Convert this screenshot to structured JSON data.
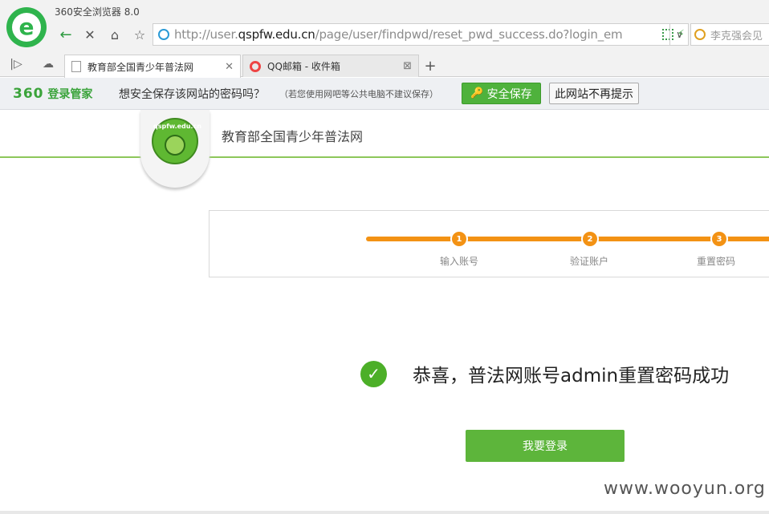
{
  "browser": {
    "title": "360安全浏览器 8.0",
    "url_prefix": "http://user.",
    "url_host": "qspfw.edu.cn",
    "url_path": "/page/user/findpwd/reset_pwd_success.do?login_em",
    "search_text": "李克强会见",
    "nav_icons": [
      "back-arrow-icon",
      "stop-icon",
      "home-icon",
      "star-icon"
    ],
    "tabs": [
      {
        "label": "教育部全国青少年普法网",
        "active": true
      },
      {
        "label": "QQ邮箱 - 收件箱",
        "active": false
      }
    ],
    "glyphs": {
      "back": "←",
      "stop": "✕",
      "home": "⌂",
      "star": "☆",
      "sidebar": "|▷",
      "cloud": "☁",
      "close": "✕",
      "boxed_close": "⊠",
      "add": "+",
      "dropdown": "∨",
      "bolt": "⚡"
    }
  },
  "password_bar": {
    "brand_num": "360",
    "brand_text": "登录管家",
    "question": "想安全保存该网站的密码吗？",
    "note": "（若您使用网吧等公共电脑不建议保存）",
    "save_label": "安全保存",
    "never_label": "此网站不再提示",
    "accent": "#4fb23c"
  },
  "page": {
    "logo_text": "qspfw.edu.cn",
    "site_title": "教育部全国青少年普法网",
    "steps": [
      {
        "num": "1",
        "label": "输入账号"
      },
      {
        "num": "2",
        "label": "验证账户"
      },
      {
        "num": "3",
        "label": "重置密码"
      }
    ],
    "step_color": "#f39214",
    "success_message": "恭喜，普法网账号admin重置密码成功",
    "login_button": "我要登录",
    "watermark": "www.wooyun.org"
  }
}
